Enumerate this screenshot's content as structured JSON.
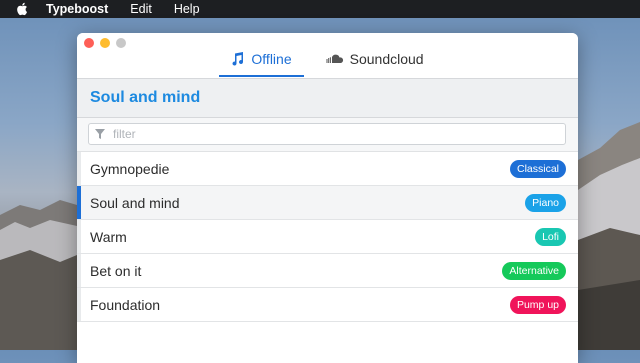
{
  "menubar": {
    "app_name": "Typeboost",
    "items": [
      "Edit",
      "Help"
    ]
  },
  "window": {
    "tabs": [
      {
        "label": "Offline",
        "icon": "music-note-icon",
        "active": true
      },
      {
        "label": "Soundcloud",
        "icon": "soundcloud-icon",
        "active": false
      }
    ],
    "header_title": "Soul and mind",
    "filter": {
      "placeholder": "filter",
      "value": ""
    },
    "tracks": [
      {
        "title": "Gymnopedie",
        "tag": "Classical",
        "tag_color": "#1d6fd6",
        "selected": false
      },
      {
        "title": "Soul and mind",
        "tag": "Piano",
        "tag_color": "#1aa2e8",
        "selected": true
      },
      {
        "title": "Warm",
        "tag": "Lofi",
        "tag_color": "#19c7b2",
        "selected": false
      },
      {
        "title": "Bet on it",
        "tag": "Alternative",
        "tag_color": "#15c95a",
        "selected": false
      },
      {
        "title": "Foundation",
        "tag": "Pump up",
        "tag_color": "#f0145a",
        "selected": false
      }
    ]
  },
  "colors": {
    "accent": "#1d6fd6",
    "header_title": "#1d8ae0"
  }
}
